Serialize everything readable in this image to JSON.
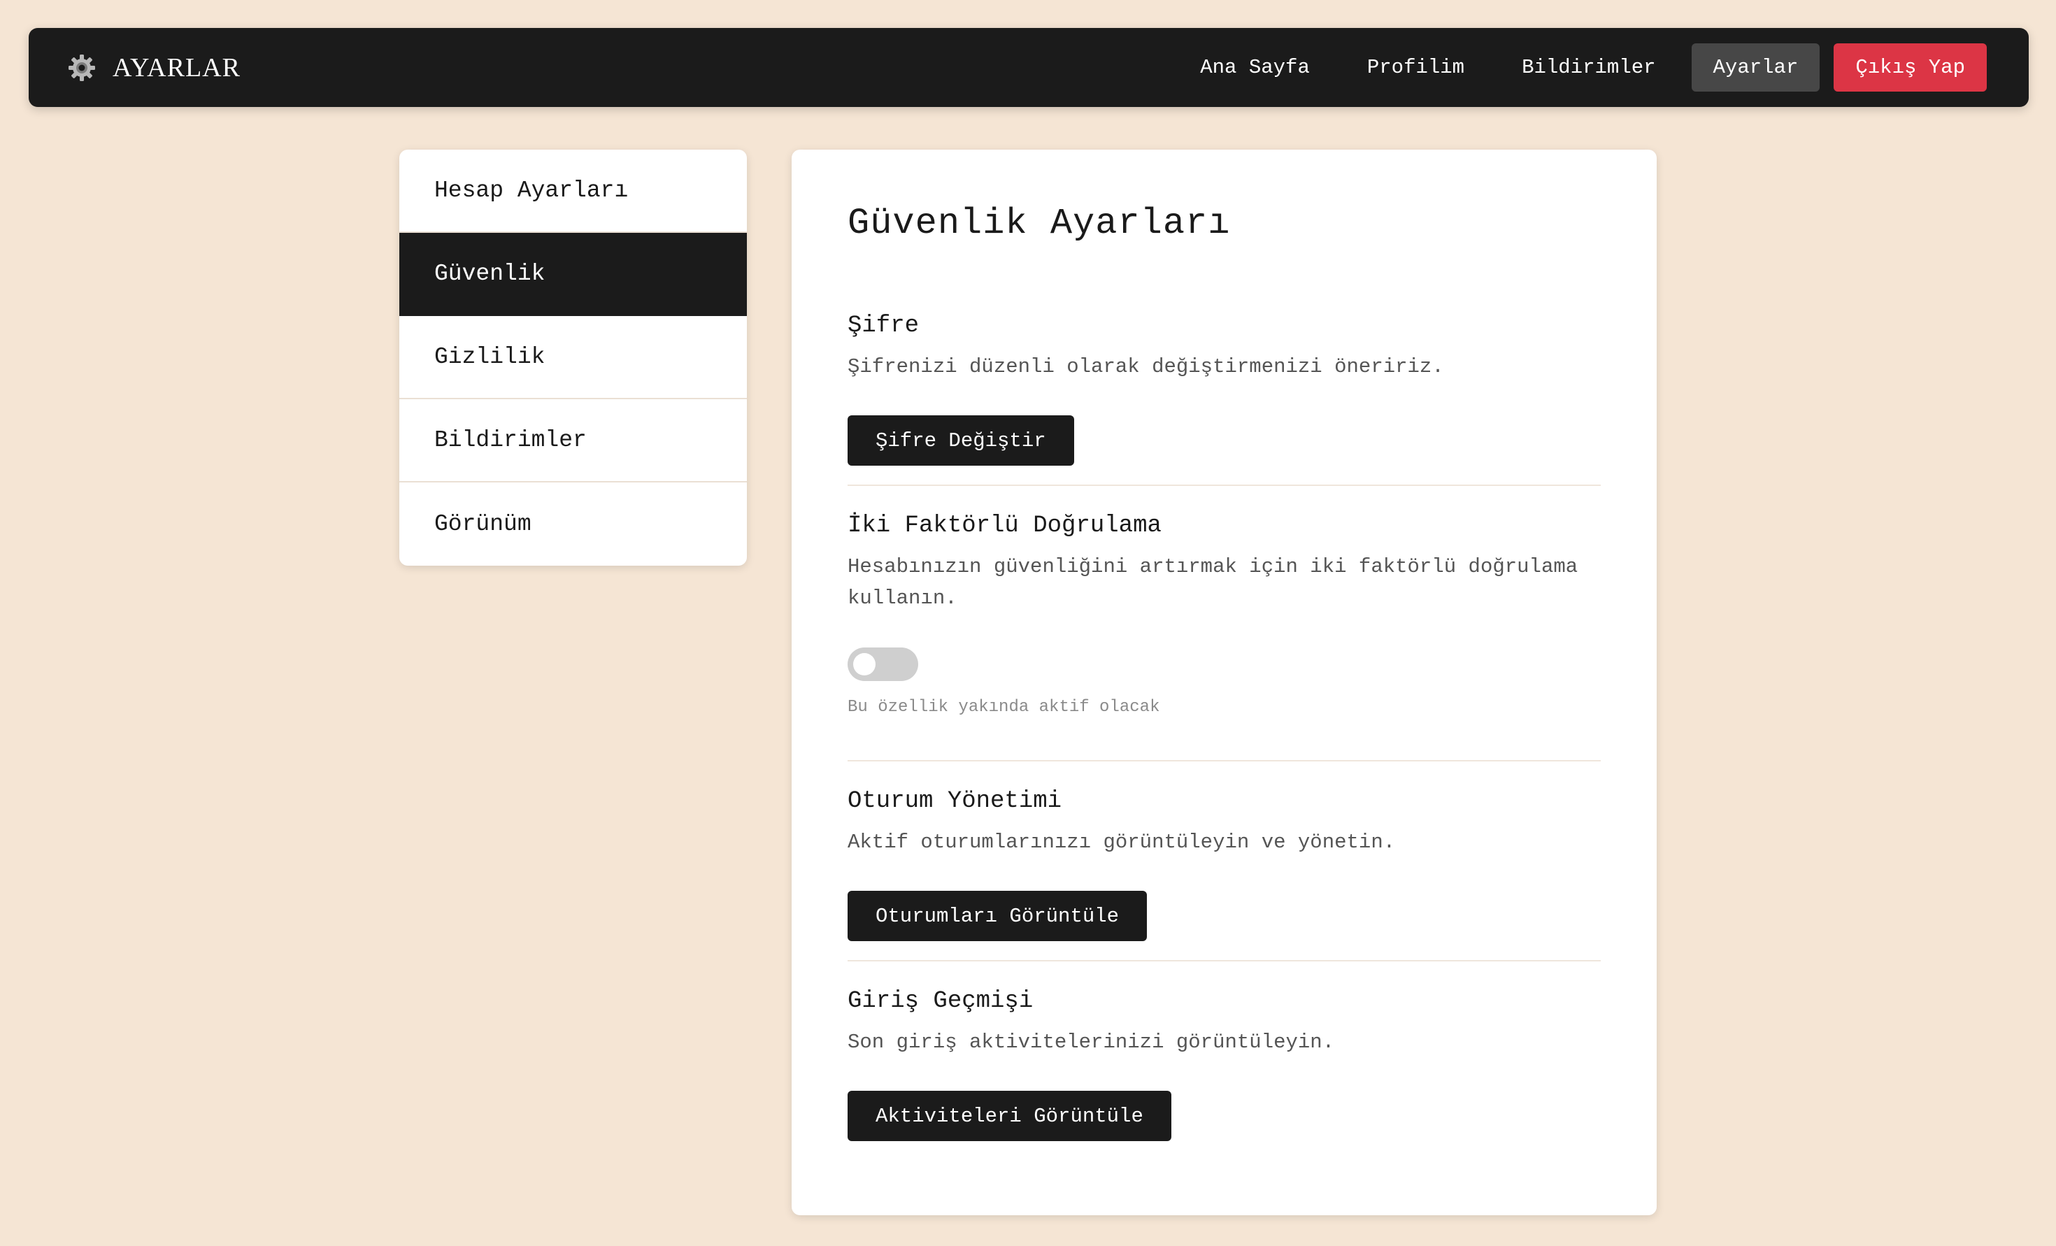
{
  "navbar": {
    "brand_icon": "gear-icon",
    "brand_title": "AYARLAR",
    "links": [
      {
        "label": "Ana Sayfa"
      },
      {
        "label": "Profilim"
      },
      {
        "label": "Bildirimler"
      },
      {
        "label": "Ayarlar",
        "active": true
      },
      {
        "label": "Çıkış Yap"
      }
    ]
  },
  "sidebar": {
    "items": [
      {
        "label": "Hesap Ayarları"
      },
      {
        "label": "Güvenlik",
        "active": true
      },
      {
        "label": "Gizlilik"
      },
      {
        "label": "Bildirimler"
      },
      {
        "label": "Görünüm"
      }
    ]
  },
  "main": {
    "title": "Güvenlik Ayarları",
    "password": {
      "title": "Şifre",
      "description": "Şifrenizi düzenli olarak değiştirmenizi öneririz.",
      "button": "Şifre Değiştir"
    },
    "two_factor": {
      "title": "İki Faktörlü Doğrulama",
      "description": "Hesabınızın güvenliğini artırmak için iki faktörlü doğrulama kullanın.",
      "enabled": false,
      "note": "Bu özellik yakında aktif olacak"
    },
    "sessions": {
      "title": "Oturum Yönetimi",
      "description": "Aktif oturumlarınızı görüntüleyin ve yönetin.",
      "button": "Oturumları Görüntüle"
    },
    "login_history": {
      "title": "Giriş Geçmişi",
      "description": "Son giriş aktivitelerinizi görüntüleyin.",
      "button": "Aktiviteleri Görüntüle"
    }
  },
  "colors": {
    "background": "#f5e5d4",
    "navbar": "#1b1b1b",
    "active_nav": "#474747",
    "logout": "#dc3545",
    "toggle_off": "#cfcfcf"
  }
}
